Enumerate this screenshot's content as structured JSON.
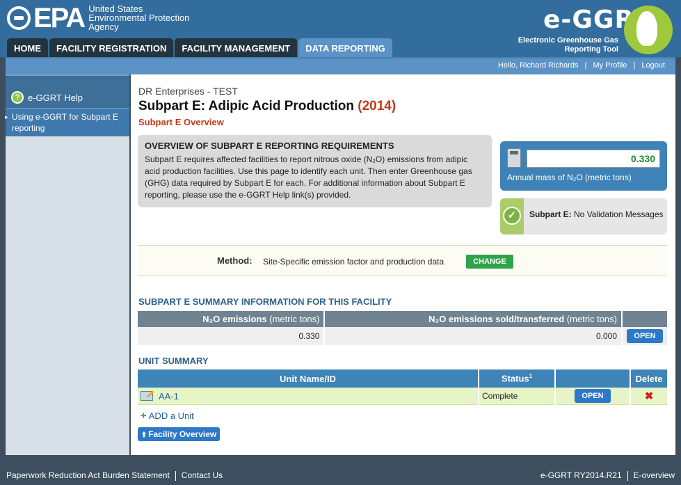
{
  "header": {
    "epa_text": "EPA",
    "agency_line1": "United States",
    "agency_line2": "Environmental Protection",
    "agency_line3": "Agency",
    "egrt_title": "e-GGRT",
    "egrt_sub1": "Electronic Greenhouse Gas",
    "egrt_sub2": "Reporting Tool"
  },
  "nav": {
    "tabs": [
      {
        "label": "HOME"
      },
      {
        "label": "FACILITY REGISTRATION"
      },
      {
        "label": "FACILITY MANAGEMENT"
      },
      {
        "label": "DATA REPORTING"
      }
    ]
  },
  "userbar": {
    "greeting": "Hello, Richard Richards",
    "profile": "My Profile",
    "logout": "Logout",
    "sep": "|"
  },
  "sidebar": {
    "help_label": "e-GGRT Help",
    "items": [
      {
        "label": "Using e-GGRT for Subpart E reporting"
      }
    ]
  },
  "main": {
    "company": "DR Enterprises - TEST",
    "title": "Subpart E: Adipic Acid Production",
    "year": "(2014)",
    "subtitle": "Subpart E Overview",
    "overview_title": "OVERVIEW OF SUBPART E REPORTING REQUIREMENTS",
    "overview_text": "Subpart E requires affected facilities to report nitrous oxide (N₂O) emissions from adipic acid production facilities. Use this page to identify each unit. Then enter Greenhouse gas (GHG) data required by Subpart E for each. For additional information about Subpart E reporting, please use the e-GGRT Help link(s) provided.",
    "mass_value": "0.330",
    "mass_label": "Annual mass of N₂O (metric tons)",
    "validation_bold": "Subpart E:",
    "validation_text": "No Validation Messages",
    "method_label": "Method:",
    "method_value": "Site-Specific emission factor and production data",
    "change_button": "CHANGE",
    "summary_title": "SUBPART E SUMMARY INFORMATION FOR THIS FACILITY",
    "summary_headers": {
      "col1_bold": "N₂O emissions",
      "col1_unit": "(metric tons)",
      "col2_bold": "N₂O emissions sold/transferred",
      "col2_unit": "(metric tons)"
    },
    "summary_values": {
      "emissions": "0.330",
      "sold": "0.000",
      "open_button": "OPEN"
    },
    "unit_title": "UNIT SUMMARY",
    "unit_headers": {
      "name": "Unit Name/ID",
      "status": "Status",
      "status_sup": "1",
      "delete": "Delete"
    },
    "units": [
      {
        "name": "AA-1",
        "status": "Complete",
        "open_button": "OPEN"
      }
    ],
    "add_unit": "ADD a Unit",
    "facility_overview": "Facility Overview"
  },
  "footer": {
    "paperwork": "Paperwork Reduction Act Burden Statement",
    "contact": "Contact Us",
    "version": "e-GGRT RY2014.R21",
    "eoverview": "E-overview"
  }
}
